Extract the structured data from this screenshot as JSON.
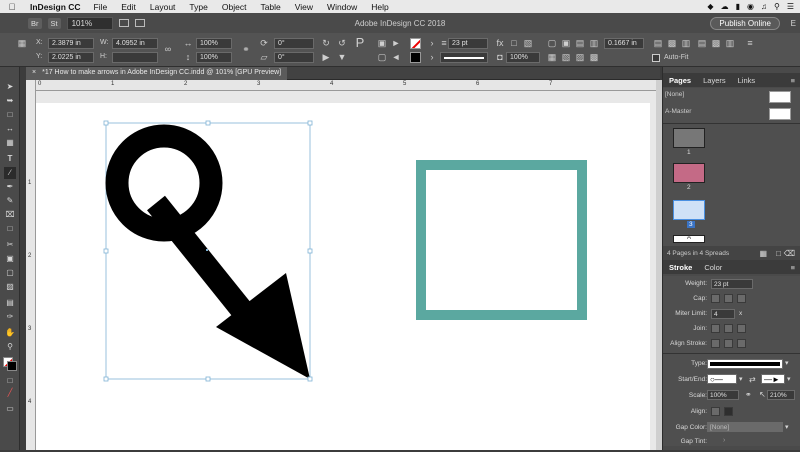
{
  "menubar": {
    "app": "InDesign CC",
    "items": [
      "File",
      "Edit",
      "Layout",
      "Type",
      "Object",
      "Table",
      "View",
      "Window",
      "Help"
    ]
  },
  "appbar": {
    "bridge": "Br",
    "stock": "St",
    "zoom": "101%",
    "title": "Adobe InDesign CC 2018",
    "publish": "Publish Online",
    "extra": "E"
  },
  "control": {
    "x_label": "X:",
    "x_value": "2.3879 in",
    "y_label": "Y:",
    "y_value": "2.0225 in",
    "w_label": "W:",
    "w_value": "4.0952 in",
    "h_label": "H:",
    "h_value": "",
    "scale_x": "100%",
    "scale_y": "100%",
    "rotate": "0°",
    "shear": "0°",
    "stroke_weight": "23 pt",
    "opacity": "100%",
    "offset": "0.1667 in",
    "autofit": "Auto-Fit"
  },
  "document_tab": "*17 How to make arrows in Adobe InDesign CC.indd @ 101% [GPU Preview]",
  "ruler": {
    "top": [
      "0",
      "1",
      "2",
      "3",
      "4",
      "5",
      "6",
      "7"
    ],
    "left": [
      "1",
      "2",
      "3",
      "4"
    ]
  },
  "pages_panel": {
    "tabs": [
      "Pages",
      "Layers",
      "Links"
    ],
    "none_label": "[None]",
    "master_label": "A-Master",
    "page_numbers": [
      "1",
      "2",
      "3"
    ],
    "master_marker": "A",
    "status": "4 Pages in 4 Spreads"
  },
  "stroke_panel": {
    "tabs": [
      "Stroke",
      "Color"
    ],
    "weight_label": "Weight:",
    "weight_value": "23 pt",
    "cap_label": "Cap:",
    "miter_label": "Miter Limit:",
    "miter_value": "4",
    "miter_unit": "x",
    "join_label": "Join:",
    "align_label": "Align Stroke:",
    "type_label": "Type:",
    "start_end_label": "Start/End:",
    "scale_label": "Scale:",
    "scale_start": "100%",
    "scale_end": "210%",
    "align2_label": "Align:",
    "gap_color_label": "Gap Color:",
    "gap_color_value": "[None]",
    "gap_tint_label": "Gap Tint:"
  },
  "colors": {
    "teal_frame": "#5ba8a0",
    "selection": "#7fb3d5"
  }
}
